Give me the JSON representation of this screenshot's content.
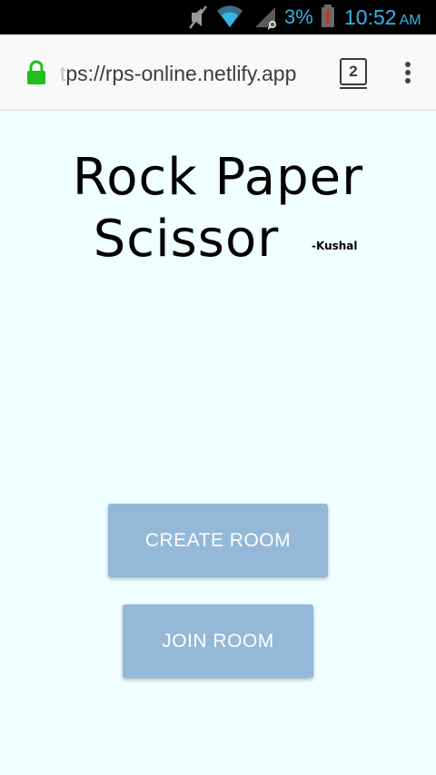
{
  "status_bar": {
    "icons": [
      "mute-icon",
      "wifi-icon",
      "signal-icon",
      "battery-alert-icon"
    ],
    "battery_percent": "3%",
    "time": "10:52",
    "ampm": "AM",
    "accent_color": "#34b5e5"
  },
  "browser": {
    "url_faded_prefix": "t",
    "url_text": "ps://rps-online.netlify.app",
    "tab_count": "2",
    "lock_color": "#1ec01e"
  },
  "page": {
    "title_line1": "Rock Paper",
    "title_line2": "Scissor",
    "byline": "-Kushal",
    "background_color": "#f0ffff",
    "button_color": "#94b8d8",
    "create_room_label": "CREATE ROOM",
    "join_room_label": "JOIN ROOM"
  }
}
